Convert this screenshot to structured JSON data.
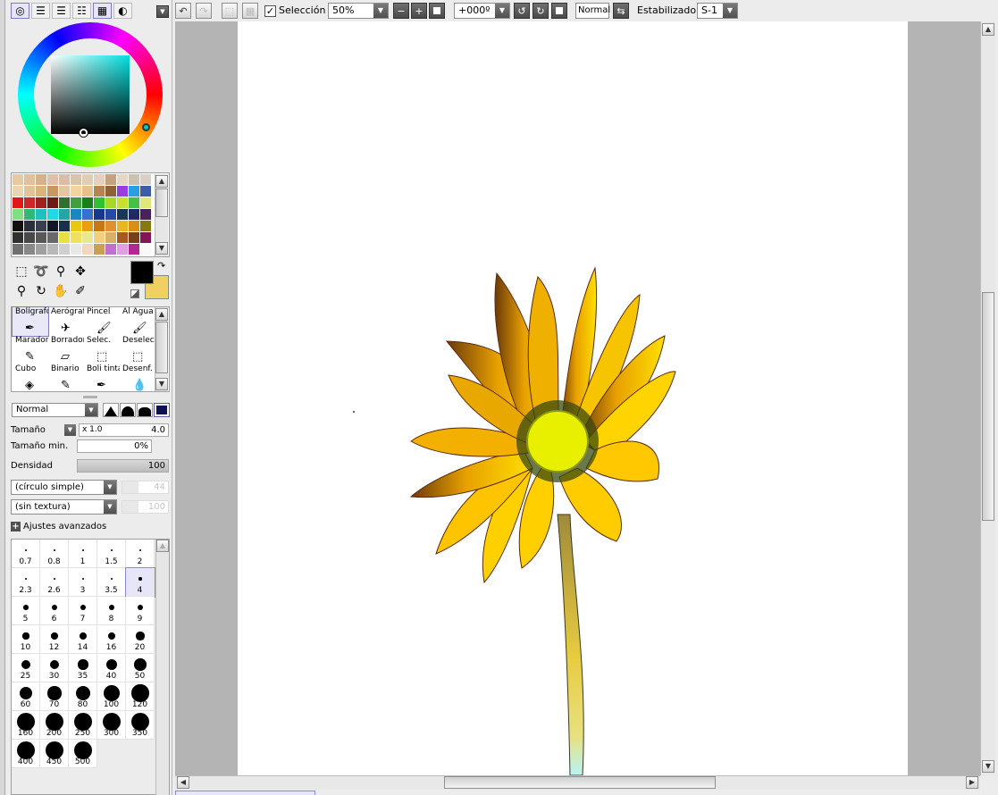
{
  "toolbar": {
    "selection_label": "Selección",
    "selection_checked": true,
    "zoom_value": "50%",
    "rotation_value": "+000º",
    "blend_mode": "Normal",
    "stabilizer_label": "Estabilizador",
    "stabilizer_value": "S-1"
  },
  "palette_tabs": [
    "color-wheel-icon",
    "sliders-icon",
    "rgb-sliders-icon",
    "swatches-list-icon",
    "swatch-grid-icon",
    "scratchpad-icon"
  ],
  "swatch_rows": [
    [
      "#e9c9a2",
      "#e2c09b",
      "#d7b08a",
      "#e3bfa8",
      "#dcbca7",
      "#d7c4ab",
      "#e0cdb3",
      "#e6d0bd",
      "#c7a07d",
      "#e6d7c4",
      "#cfc1b2",
      "#d8d0c6"
    ],
    [
      "#ecd3b1",
      "#e0c398",
      "#d9b47d",
      "#c79862",
      "#e4c7a2",
      "#f2d49c",
      "#e6c189",
      "#b38552",
      "#8c6236",
      "#9a3ce0",
      "#28a0e0",
      "#3e5ca8"
    ],
    [
      "#e01818",
      "#c82828",
      "#a02020",
      "#701818",
      "#306f30",
      "#40a040",
      "#188018",
      "#30c030",
      "#a8d828",
      "#c8e030",
      "#48c048",
      "#e0e878"
    ],
    [
      "#80e080",
      "#30b878",
      "#20c0c0",
      "#20d8e8",
      "#20a8a8",
      "#1888c0",
      "#3870d0",
      "#183890",
      "#2848a8",
      "#183858",
      "#202868",
      "#48205c"
    ],
    [
      "#101010",
      "#283040",
      "#384050",
      "#101828",
      "#183048",
      "#e8c810",
      "#e8a010",
      "#c87810",
      "#e09030",
      "#e8b820",
      "#d89018",
      "#887810"
    ],
    [
      "#303030",
      "#484848",
      "#585858",
      "#686868",
      "#e8e040",
      "#f0e060",
      "#e8e890",
      "#f0d080",
      "#d8b068",
      "#a85820",
      "#784018",
      "#801858"
    ],
    [
      "#707070",
      "#888888",
      "#a0a0a0",
      "#b8b8b8",
      "#d0d0d0",
      "#e8e8e8",
      "#f0d8c0",
      "#c8a058",
      "#c070d0",
      "#e0a0e0",
      "#b02890",
      "#f8f8f8"
    ]
  ],
  "select_tools": [
    "marquee-select-icon",
    "lasso-select-icon",
    "magic-wand-icon",
    "move-icon",
    "zoom-icon",
    "rotate-icon",
    "hand-icon",
    "eyedropper-icon"
  ],
  "colors": {
    "primary": "#000000",
    "secondary": "#f0d060",
    "accent": "#8080d0"
  },
  "tools": [
    {
      "label": "Bolígrafc",
      "icon": "pen-icon",
      "glyph": "✒"
    },
    {
      "label": "Aerógraf",
      "icon": "airbrush-icon",
      "glyph": "✈"
    },
    {
      "label": "Pincel",
      "icon": "brush-icon",
      "glyph": "🖌"
    },
    {
      "label": "Al Agua",
      "icon": "watercolor-icon",
      "glyph": "🖌"
    },
    {
      "label": "Marador",
      "icon": "marker-icon",
      "glyph": "✎"
    },
    {
      "label": "Borrador",
      "icon": "eraser-icon",
      "glyph": "▱"
    },
    {
      "label": "Selec.",
      "icon": "select-pen-icon",
      "glyph": "⬚"
    },
    {
      "label": "Deselec.",
      "icon": "deselect-pen-icon",
      "glyph": "⬚"
    },
    {
      "label": "Cubo",
      "icon": "bucket-icon",
      "glyph": "◈"
    },
    {
      "label": "Binario",
      "icon": "binary-pen-icon",
      "glyph": "✎"
    },
    {
      "label": "Boli tinta",
      "icon": "ink-pen-icon",
      "glyph": "✒"
    },
    {
      "label": "Desenf.",
      "icon": "blur-icon",
      "glyph": "💧"
    }
  ],
  "brush": {
    "mode": "Normal",
    "size_label": "Tamaño",
    "size_multiplier": "x 1.0",
    "size_value": "4.0",
    "min_size_label": "Tamaño min.",
    "min_size_value": "0%",
    "density_label": "Densidad",
    "density_value": "100",
    "shape": "(círculo simple)",
    "shape_value": "44",
    "texture": "(sin textura)",
    "texture_value": "100",
    "advanced_label": "Ajustes avanzados"
  },
  "brush_sizes": [
    "0.7",
    "0.8",
    "1",
    "1.5",
    "2",
    "2.3",
    "2.6",
    "3",
    "3.5",
    "4",
    "5",
    "6",
    "7",
    "8",
    "9",
    "10",
    "12",
    "14",
    "16",
    "20",
    "25",
    "30",
    "35",
    "40",
    "50",
    "60",
    "70",
    "80",
    "100",
    "120",
    "160",
    "200",
    "250",
    "300",
    "350",
    "400",
    "450",
    "500"
  ],
  "selected_size": "4"
}
